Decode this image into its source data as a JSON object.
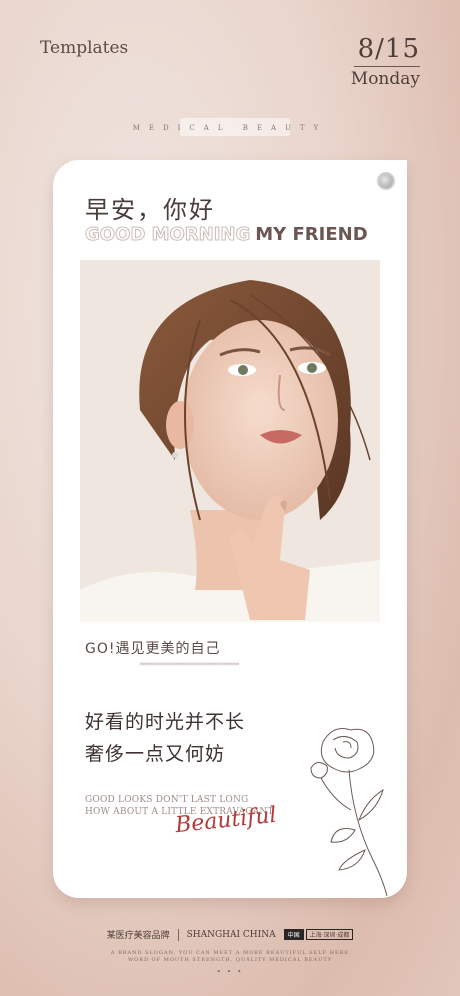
{
  "header": {
    "brand": "Templates",
    "date": "8/15",
    "day": "Monday",
    "kicker": "MEDICAL BEAUTY"
  },
  "card": {
    "greeting_cn": "早安，你好",
    "greeting_en_outline": "GOOD MORNING",
    "greeting_en_solid": "MY FRIEND",
    "go_line": "GO!遇见更美的自己",
    "chevrons": "»»»»»»»»»»»»»»»»»»»»»»»»»»»»»»»",
    "quote_line1": "好看的时光并不长",
    "quote_line2": "奢侈一点又何妨",
    "en_line1": "GOOD LOOKS DON'T LAST LONG",
    "en_line2": "HOW ABOUT A LITTLE EXTRAVAGANT",
    "script_word": "Beautiful"
  },
  "footer": {
    "brand_cn": "某医疗美容品牌",
    "city_en": "SHANGHAI CHINA",
    "country_cn": "中国",
    "cities_cn": "上海·深圳·成都",
    "slogan_line1": "A BRAND SLOGAN, YOU CAN MEET A MORE BEAUTIFUL SELF HERE",
    "slogan_line2": "WORD OF MOUTH STRENGTH, QUALITY MEDICAL BEAUTY",
    "dots": "• • •"
  },
  "colors": {
    "accent": "#b33a3a",
    "text": "#4b3d39",
    "background": "#e9d5cc"
  },
  "icons": [
    "card-dot-icon",
    "rose-line-art-icon",
    "portrait-photo"
  ]
}
